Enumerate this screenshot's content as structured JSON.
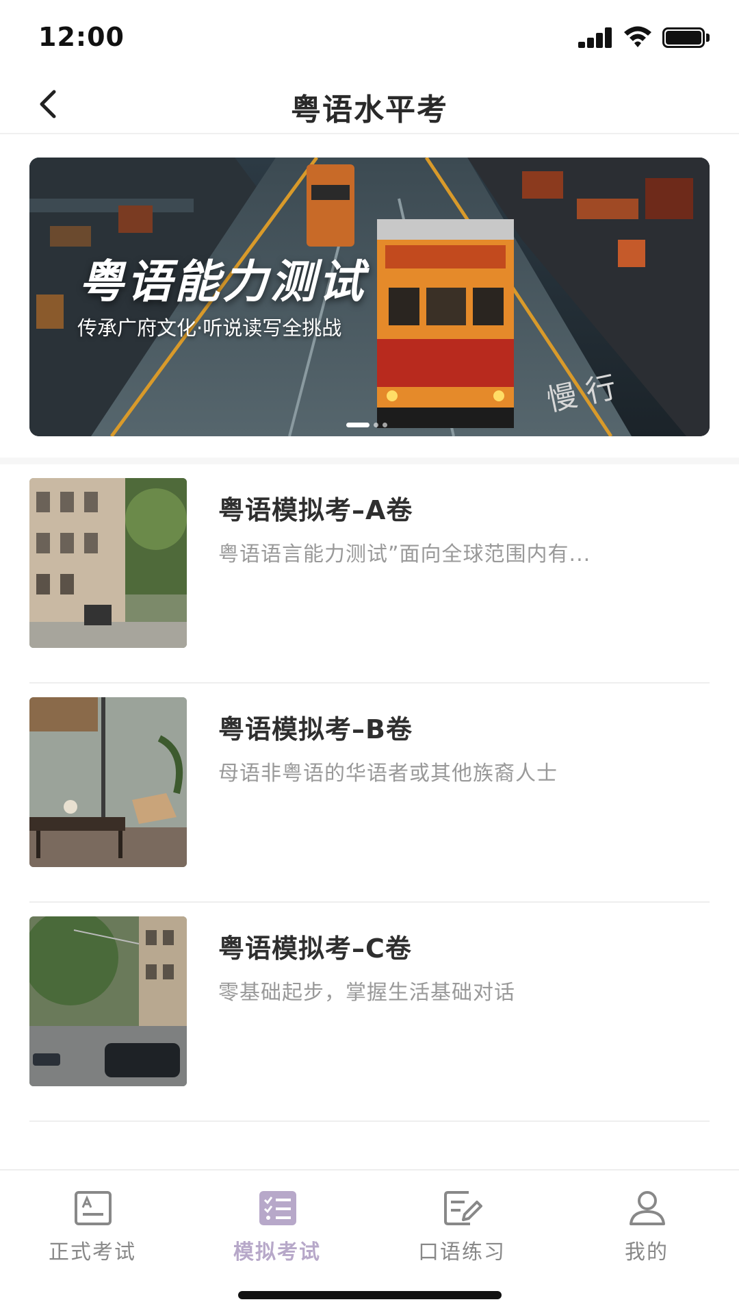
{
  "status_bar": {
    "time": "12:00"
  },
  "nav": {
    "title": "粤语水平考"
  },
  "banner": {
    "title": "粤语能力测试",
    "subtitle": "传承广府文化·听说读写全挑战",
    "slide_count": 3,
    "active_slide": 1
  },
  "items": [
    {
      "title": "粤语模拟考–A卷",
      "desc": "粤语语言能力测试”面向全球范围内有..."
    },
    {
      "title": "粤语模拟考–B卷",
      "desc": "母语非粤语的华语者或其他族裔人士"
    },
    {
      "title": "粤语模拟考–C卷",
      "desc": "零基础起步，掌握生活基础对话"
    }
  ],
  "tabs": [
    {
      "label": "正式考试",
      "icon": "exam-card-icon",
      "active": false
    },
    {
      "label": "模拟考试",
      "icon": "checklist-icon",
      "active": true
    },
    {
      "label": "口语练习",
      "icon": "edit-note-icon",
      "active": false
    },
    {
      "label": "我的",
      "icon": "user-icon",
      "active": false
    }
  ],
  "colors": {
    "active_tab": "#b7a8c9",
    "inactive_tab": "#888888",
    "title_text": "#2f2f2f",
    "desc_text": "#999999"
  }
}
